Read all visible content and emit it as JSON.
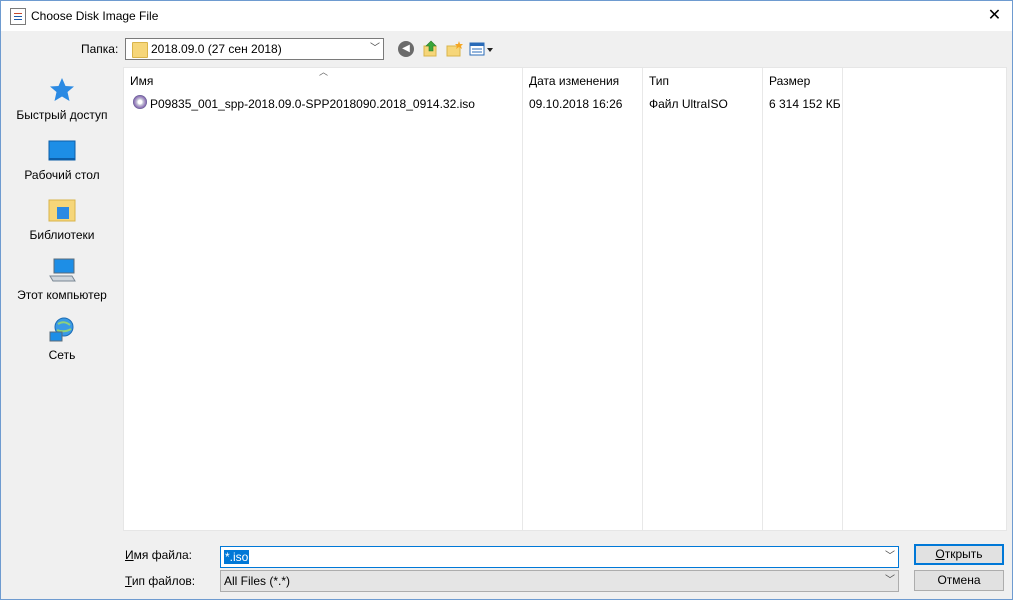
{
  "window": {
    "title": "Choose Disk Image File",
    "close_glyph": "✕"
  },
  "toolbar": {
    "look_in_label": "Папка:",
    "look_in_value": "2018.09.0 (27 сен 2018)",
    "icons": [
      "back-icon",
      "up-folder-icon",
      "new-folder-icon",
      "view-menu-icon"
    ]
  },
  "sidebar": {
    "items": [
      {
        "label": "Быстрый доступ",
        "icon": "star-icon"
      },
      {
        "label": "Рабочий стол",
        "icon": "desktop-icon"
      },
      {
        "label": "Библиотеки",
        "icon": "libraries-icon"
      },
      {
        "label": "Этот компьютер",
        "icon": "computer-icon"
      },
      {
        "label": "Сеть",
        "icon": "network-icon"
      }
    ]
  },
  "file_list": {
    "columns": [
      "Имя",
      "Дата изменения",
      "Тип",
      "Размер"
    ],
    "rows": [
      {
        "name": "P09835_001_spp-2018.09.0-SPP2018090.2018_0914.32.iso",
        "modified": "09.10.2018 16:26",
        "type": "Файл UltraISO",
        "size": "6 314 152 КБ"
      }
    ]
  },
  "filename": {
    "label_prefix": "И",
    "label_rest": "мя файла:",
    "value": "*.iso"
  },
  "filetype": {
    "label_prefix": "Т",
    "label_rest": "ип файлов:",
    "value": "All Files (*.*)"
  },
  "buttons": {
    "open_prefix": "О",
    "open_rest": "ткрыть",
    "cancel": "Отмена"
  },
  "colors": {
    "accent": "#0078d7",
    "border": "#6e9bd0"
  }
}
